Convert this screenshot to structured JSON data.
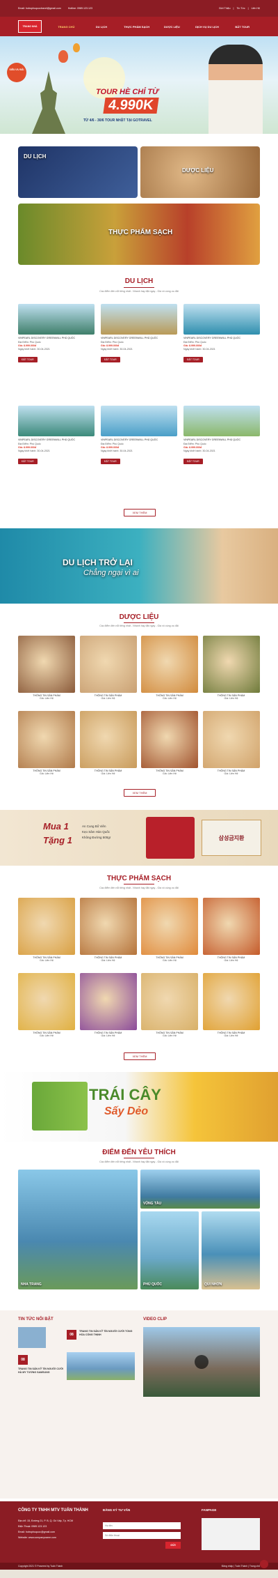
{
  "topbar": {
    "email": "Email: hotrophuquoctravel@gmail.com",
    "hotline": "Hotline: 0989.123.123",
    "links": [
      "Giới Thiệu",
      "Tin Tức",
      "Liên Hệ"
    ]
  },
  "nav": {
    "logo": "TRANG NHÀ",
    "items": [
      "TRANG CHỦ",
      "DU LỊCH",
      "THỰC PHẨM SẠCH",
      "DƯỢC LIỆU",
      "DỊCH VỤ DU LỊCH",
      "BẤT TOUR"
    ]
  },
  "hero": {
    "badge": "SIÊU ƯU ĐÃI",
    "line1": "TOUR HÈ CHỈ TỪ",
    "price": "4.990K",
    "line3": "TỪ 4/6 - 30/6 TOUR NHẬT TẠI GOTRAVEL"
  },
  "categories": [
    {
      "label": "DU LỊCH",
      "color": "#2a3f7a"
    },
    {
      "label": "DƯỢC LIỆU",
      "color": "#b8865a"
    },
    {
      "label": "THỰC PHẨM SẠCH",
      "color": "#6f8a34"
    }
  ],
  "sections": {
    "tour_title": "DU LỊCH",
    "subtitle": "Các điểm đến nổi tiếng nhất - Nhanh hay đặt ngay - Giá vô cùng ưu đãi",
    "duoc_lieu_title": "DƯỢC LIỆU",
    "thuc_pham_title": "THỰC PHẨM SẠCH",
    "diem_den_title": "ĐIỂM ĐẾN YÊU THÍCH",
    "more_label": "XEM THÊM"
  },
  "tours": [
    {
      "name": "VINPEARL DISCOVERY GREENWILL PHÚ QUỐC",
      "place": "Địa Điểm: Phú Quốc",
      "price": "Giá: 8.999.000đ",
      "date": "Ngày khởi hành: 30-04-2021",
      "btn": "ĐẶT TOUR",
      "color": "#3f7f6a"
    },
    {
      "name": "VINPEARL DISCOVERY GREENWILL PHÚ QUỐC",
      "place": "Địa Điểm: Phú Quốc",
      "price": "Giá: 8.999.000đ",
      "date": "Ngày khởi hành: 30-04-2021",
      "btn": "ĐẶT TOUR",
      "color": "#b99a57"
    },
    {
      "name": "VINPEARL DISCOVERY GREENWILL PHÚ QUỐC",
      "place": "Địa Điểm: Phú Quốc",
      "price": "Giá: 8.999.000đ",
      "date": "Ngày khởi hành: 30-04-2021",
      "btn": "ĐẶT TOUR",
      "color": "#2f8fae"
    },
    {
      "name": "VINPEARL DISCOVERY GREENWILL PHÚ QUỐC",
      "place": "Địa Điểm: Phú Quốc",
      "price": "Giá: 8.999.000đ",
      "date": "Ngày khởi hành: 30-04-2021",
      "btn": "ĐẶT TOUR",
      "color": "#3b8a7a"
    },
    {
      "name": "VINPEARL DISCOVERY GREENWILL PHÚ QUỐC",
      "place": "Địa Điểm: Phú Quốc",
      "price": "Giá: 8.999.000đ",
      "date": "Ngày khởi hành: 30-04-2021",
      "btn": "ĐẶT TOUR",
      "color": "#4a9fc8"
    },
    {
      "name": "VINPEARL DISCOVERY GREENWILL PHÚ QUỐC",
      "place": "Địa Điểm: Phú Quốc",
      "price": "Giá: 8.999.000đ",
      "date": "Ngày khởi hành: 30-04-2021",
      "btn": "ĐẶT TOUR",
      "color": "#8bb86a"
    }
  ],
  "banner1": {
    "line1": "DU LỊCH TRỞ LẠI",
    "line2": "Chẳng ngại vì ai"
  },
  "product_label": "THÔNG TIN SẢN PHẨM",
  "product_price": "Giá: Liên Hệ",
  "duoc_lieu_colors": [
    "#8a5a3a",
    "#c9a073",
    "#d18a3c",
    "#6e7a3a",
    "#b07a4a",
    "#c89a5a",
    "#a0522d",
    "#d0a26a"
  ],
  "thuc_pham_colors": [
    "#d9a042",
    "#b5733a",
    "#e08a3a",
    "#c45a2a",
    "#e0b040",
    "#8a4a9a",
    "#d8b068",
    "#e0a030"
  ],
  "banner2": {
    "mua": "Mua 1",
    "tang": "Tặng 1",
    "line1": "An Cung Bổ Viên",
    "line2": "Kẹo Sâm Hàn Quốc",
    "line3": "Không Đường 500gr",
    "brand": "삼성금지환"
  },
  "banner3": {
    "line1": "TRÁI CÂY",
    "line2": "Sấy Dẻo"
  },
  "destinations": [
    {
      "label": "NHA TRANG",
      "color": "#5a8fb0"
    },
    {
      "label": "VŨNG TÀU",
      "color": "#3f7aa0"
    },
    {
      "label": "PHÚ QUỐC",
      "color": "#6aa8c8"
    },
    {
      "label": "QUI NHƠN",
      "color": "#4a90b8"
    }
  ],
  "news": {
    "title": "TIN TỨC NỔI BẬT",
    "video_title": "VIDEO CLIP",
    "items": [
      {
        "day": "08",
        "month": "Th8",
        "title": "TRANG TIN SẢN KỸ TÍN NGƯỜI CƯỚI TỔNG HÒA CÔNG THỊNH"
      },
      {
        "day": "08",
        "month": "Th8",
        "title": "TRANG TIN SẢN KỸ TÍN NGƯỜI CƯỚI HÀ MY TƯƠNG SAMSUNG"
      }
    ]
  },
  "footer": {
    "company": "CÔNG TY TNHH MTV TUẤN THÀNH",
    "address": "Địa chỉ: 15, Đường 21, P. B, Q. Gò Vấp, Tp. HCM",
    "phone": "Điện Thoại: 0989.123.123",
    "email": "Email: hotrophuquoc@gmail.com",
    "website": "Website: www.companyname.com",
    "consult_title": "ĐĂNG KÝ TƯ VẤN",
    "fanpage_title": "FANPAGE",
    "name_ph": "Họ tên",
    "phone_ph": "Số điện thoại",
    "send": "GỬI"
  },
  "copyright": "Copyright 2021 © Powered by Tuấn Thành",
  "copy_links": [
    "Đăng nhập",
    "Tuấn Thành",
    "Trang chủ"
  ]
}
